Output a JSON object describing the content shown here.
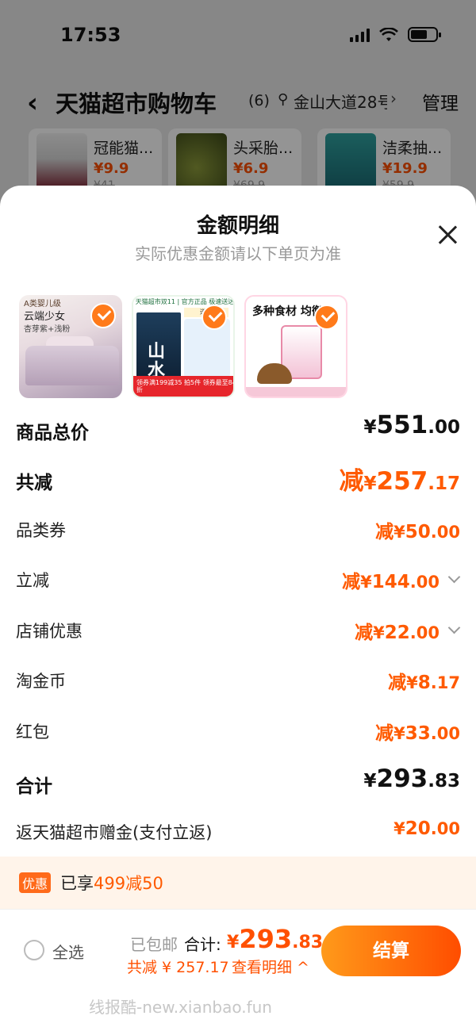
{
  "status_bar": {
    "time": "17:53"
  },
  "cart_header": {
    "title": "天猫超市购物车",
    "count": "(6)",
    "address": "金山大道28号",
    "manage_label": "管理"
  },
  "recommendations": [
    {
      "name": "冠能猫...",
      "price": "¥9.9",
      "old_price": "¥41"
    },
    {
      "name": "头采胎...",
      "price": "¥6.9",
      "old_price": "¥69.9"
    },
    {
      "name": "洁柔抽...",
      "price": "¥19.9",
      "old_price": "¥59.9"
    }
  ],
  "sheet": {
    "title": "金额明细",
    "subtitle": "实际优惠金额请以下单页为准",
    "products": [
      {
        "tag": "A类婴儿级",
        "title": "云端少女",
        "sub": "杏芽紫+浅粉",
        "checked": true
      },
      {
        "header": "天猫超市双11 | 官方正品 极速送达",
        "cover_text": "山水",
        "banner": "道理",
        "bar_text": "领券满199减35 拍5件 领券最至84折",
        "checked": true
      },
      {
        "head": "多种食材 均衡",
        "checked": true
      }
    ],
    "rows": [
      {
        "label": "商品总价",
        "prefix": "",
        "yen": "¥",
        "int": "551",
        "cents": ".00"
      },
      {
        "label": "共减",
        "prefix": "减",
        "yen": "¥",
        "int": "257",
        "cents": ".17"
      },
      {
        "label": "品类券",
        "prefix": "减",
        "yen": "¥",
        "int": "50",
        "cents": ".00"
      },
      {
        "label": "立减",
        "prefix": "减",
        "yen": "¥",
        "int": "144",
        "cents": ".00"
      },
      {
        "label": "店铺优惠",
        "prefix": "减",
        "yen": "¥",
        "int": "22",
        "cents": ".00"
      },
      {
        "label": "淘金币",
        "prefix": "减",
        "yen": "¥",
        "int": "8",
        "cents": ".17"
      },
      {
        "label": "红包",
        "prefix": "减",
        "yen": "¥",
        "int": "33",
        "cents": ".00"
      },
      {
        "label": "合计",
        "prefix": "",
        "yen": "¥",
        "int": "293",
        "cents": ".83"
      },
      {
        "label": "返天猫超市赠金(支付立返)",
        "prefix": "",
        "yen": "¥",
        "int": "20",
        "cents": ".00"
      }
    ]
  },
  "promo": {
    "tag": "优惠",
    "text_prefix": "已享",
    "highlight": "499减50"
  },
  "footer": {
    "select_all": "全选",
    "shipping": "已包邮",
    "total_label": "合计:",
    "total_yen": "¥",
    "total_int": "293",
    "total_cents": ".83",
    "reduce_text": "共减 ¥ 257.17",
    "detail_link": "查看明细 ^",
    "checkout": "结算"
  },
  "watermark": "线报酷-new.xianbao.fun",
  "colors": {
    "accent": "#ff5000",
    "checkout_start": "#ff9a1a",
    "checkout_end": "#ff4d00"
  }
}
